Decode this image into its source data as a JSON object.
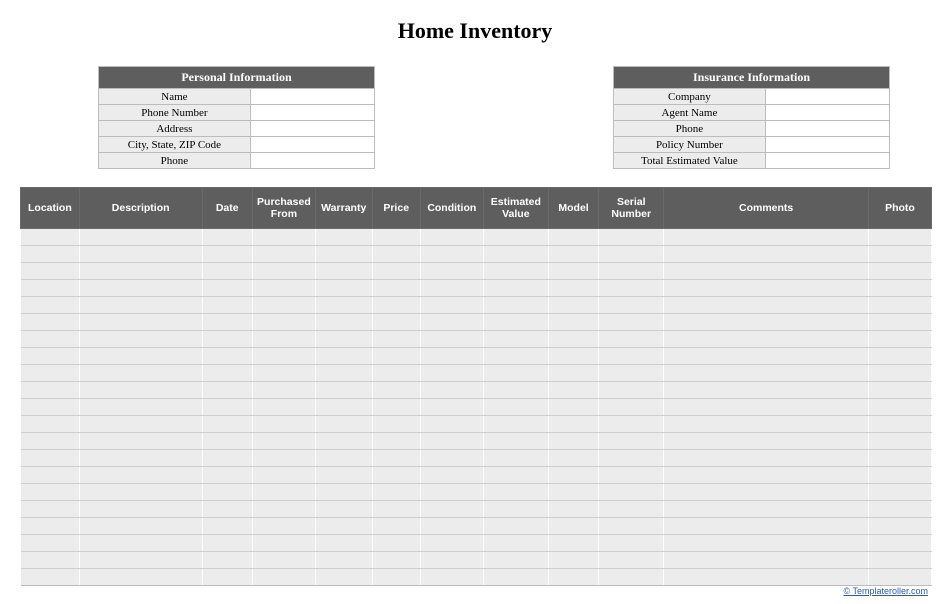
{
  "title": "Home Inventory",
  "personal": {
    "header": "Personal Information",
    "rows": [
      {
        "label": "Name",
        "value": ""
      },
      {
        "label": "Phone Number",
        "value": ""
      },
      {
        "label": "Address",
        "value": ""
      },
      {
        "label": "City, State, ZIP Code",
        "value": ""
      },
      {
        "label": "Phone",
        "value": ""
      }
    ]
  },
  "insurance": {
    "header": "Insurance Information",
    "rows": [
      {
        "label": "Company",
        "value": ""
      },
      {
        "label": "Agent Name",
        "value": ""
      },
      {
        "label": "Phone",
        "value": ""
      },
      {
        "label": "Policy Number",
        "value": ""
      },
      {
        "label": "Total Estimated Value",
        "value": ""
      }
    ]
  },
  "columns": [
    "Location",
    "Description",
    "Date",
    "Purchased From",
    "Warranty",
    "Price",
    "Condition",
    "Estimated Value",
    "Model",
    "Serial Number",
    "Comments",
    "Photo"
  ],
  "row_count": 21,
  "footer": "© Templateroller.com"
}
